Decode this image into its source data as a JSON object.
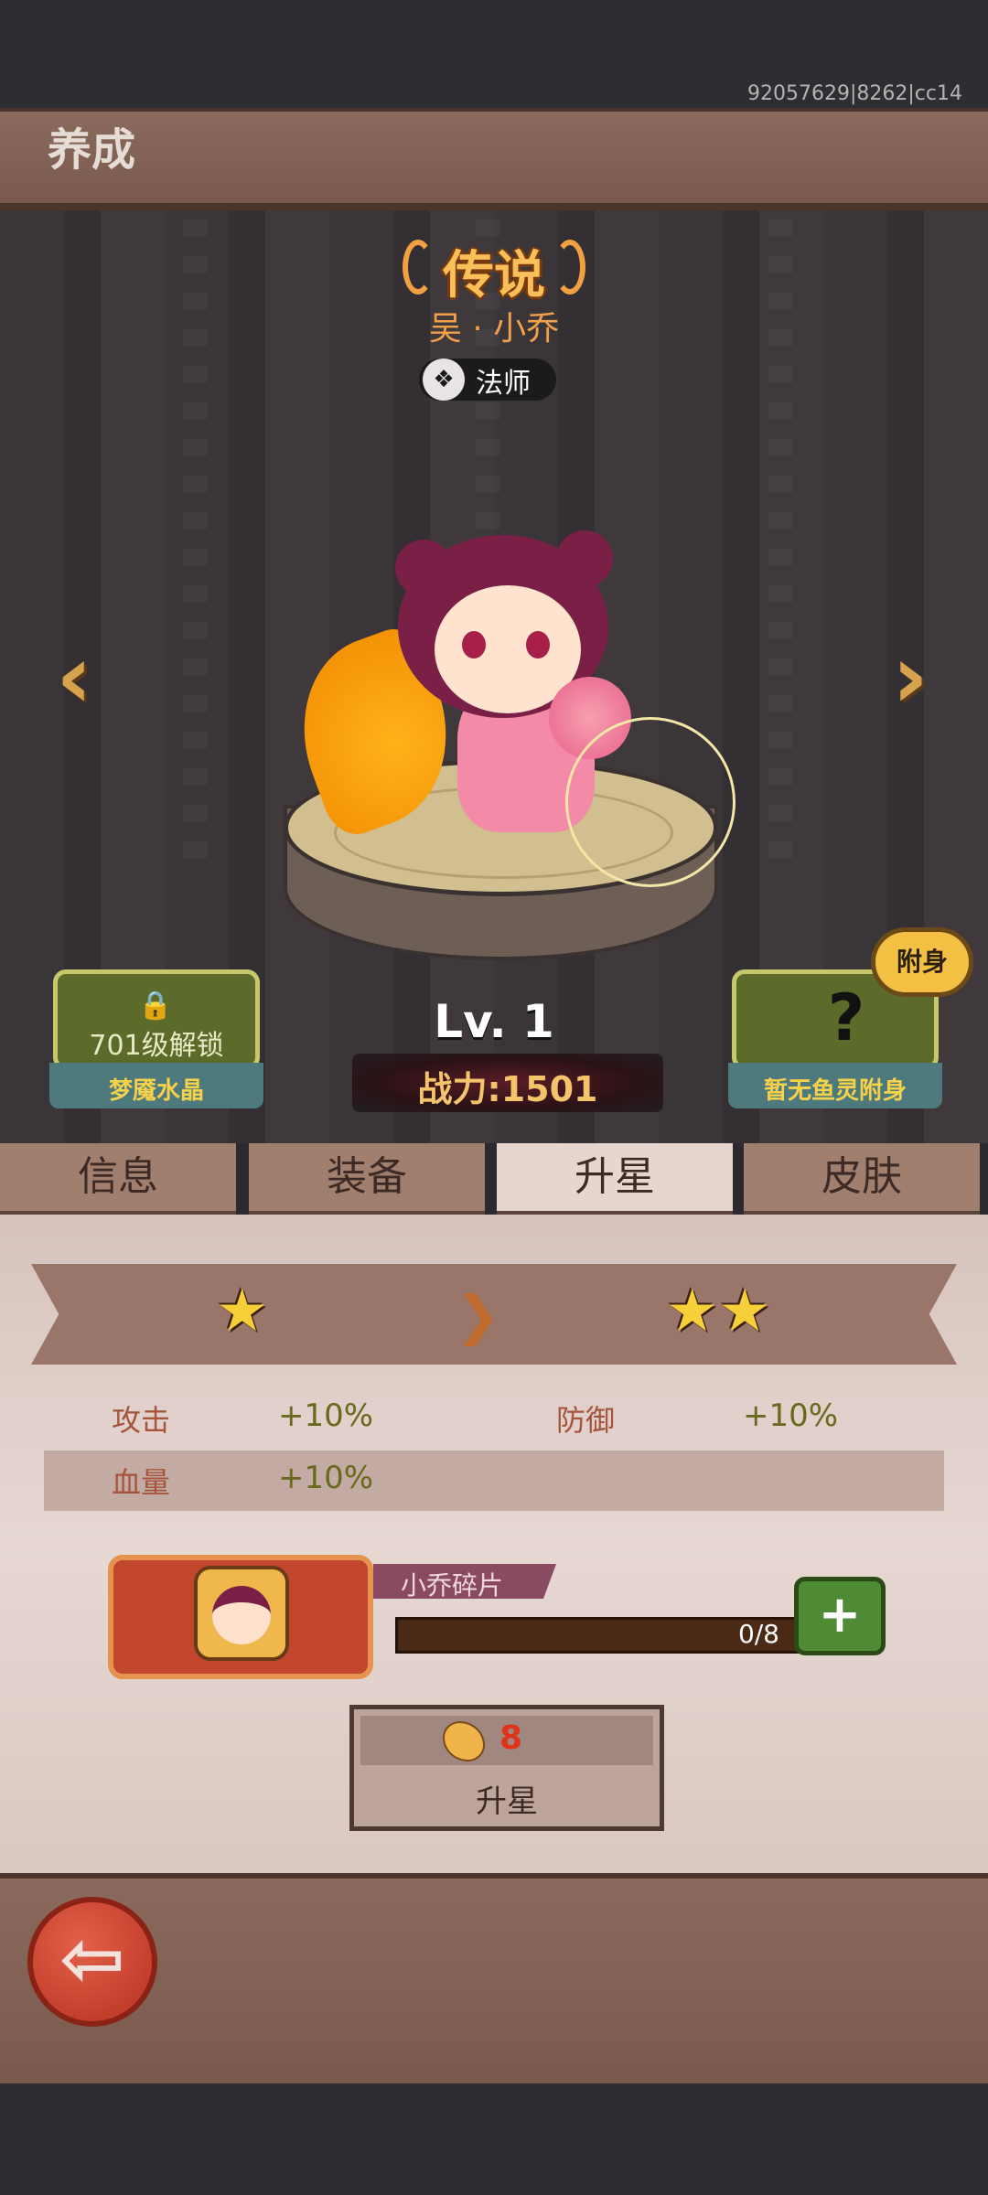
{
  "status": {
    "version": "92057629|8262|cc14"
  },
  "header": {
    "title": "养成"
  },
  "hero": {
    "rarity": "传说",
    "name": "吴 · 小乔",
    "class": "法师",
    "level": "Lv. 1",
    "power": "战力:1501"
  },
  "nav": {
    "prev": "‹",
    "next": "›"
  },
  "crystal": {
    "unlock_text": "701级解锁",
    "label": "梦魇水晶"
  },
  "spirit": {
    "icon": "?",
    "label": "暂无鱼灵附身",
    "attach": "附身"
  },
  "tabs": [
    {
      "label": "信息"
    },
    {
      "label": "装备"
    },
    {
      "label": "升星"
    },
    {
      "label": "皮肤"
    }
  ],
  "star_upgrade": {
    "from_stars": "★",
    "to_stars": "★★",
    "arrow": "❯",
    "stats": [
      {
        "name": "攻击",
        "value": "+10%"
      },
      {
        "name": "防御",
        "value": "+10%"
      },
      {
        "name": "血量",
        "value": "+10%"
      }
    ],
    "shard": {
      "name": "小乔碎片",
      "count": "0/8",
      "progress": 0,
      "add": "+"
    },
    "cost": "8",
    "button_label": "升星"
  },
  "back": {
    "icon": "⇦"
  }
}
